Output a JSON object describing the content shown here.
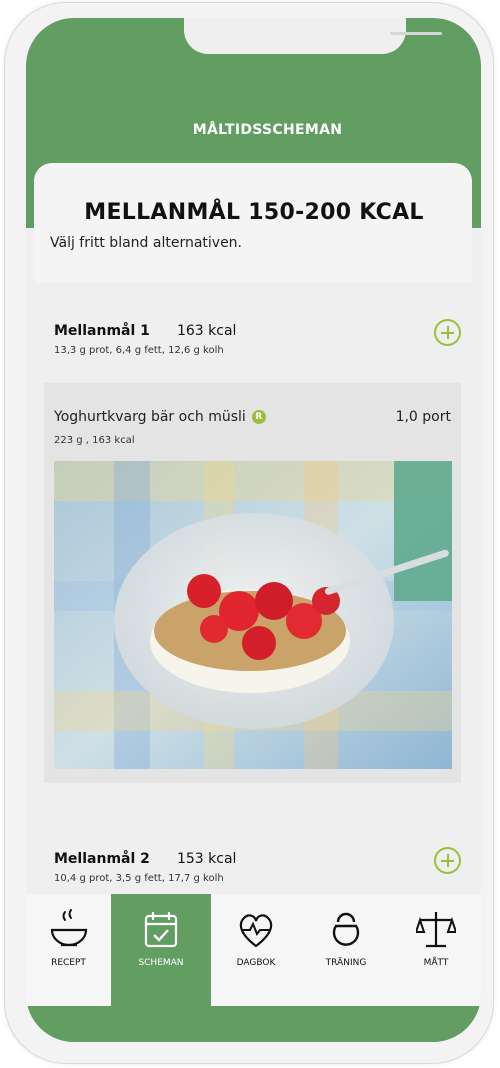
{
  "header": {
    "title": "MÅLTIDSSCHEMAN"
  },
  "page": {
    "title": "MELLANMÅL 150-200 KCAL",
    "subtitle": "Välj fritt bland alternativen."
  },
  "meals": [
    {
      "name": "Mellanmål 1",
      "kcal": "163 kcal",
      "macros": "13,3 g prot, 6,4 g fett, 12,6 g kolh"
    },
    {
      "name": "Mellanmål 2",
      "kcal": "153 kcal",
      "macros": "10,4 g prot, 3,5 g fett, 17,7 g kolh"
    }
  ],
  "recipe": {
    "name": "Yoghurtkvarg bär och müsli",
    "badge": "R",
    "portion": "1,0 port",
    "meta": "223 g , 163 kcal",
    "image_icon": "yoghurt-bowl-photo"
  },
  "tabs": [
    {
      "label": "RECEPT",
      "icon": "bowl-icon"
    },
    {
      "label": "SCHEMAN",
      "icon": "calendar-check-icon",
      "active": true
    },
    {
      "label": "DAGBOK",
      "icon": "heart-pulse-icon"
    },
    {
      "label": "TRÄNING",
      "icon": "kettlebell-icon"
    },
    {
      "label": "MÅTT",
      "icon": "scale-icon"
    }
  ],
  "colors": {
    "brand_green": "#629d62",
    "accent_lime": "#9bbf3c",
    "background": "#efefef"
  }
}
